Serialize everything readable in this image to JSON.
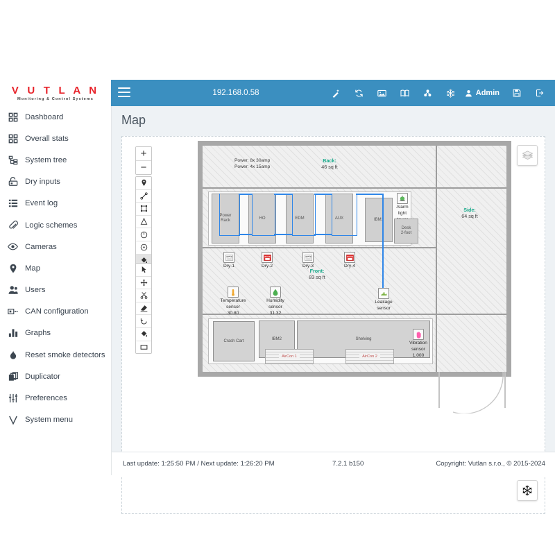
{
  "brand": {
    "name": "V U T L A N",
    "tagline": "Monitoring & Control Systems"
  },
  "header": {
    "ip": "192.168.0.58",
    "user": "Admin",
    "icons": [
      {
        "name": "magic-wand-icon",
        "title": "Wizard"
      },
      {
        "name": "refresh-icon",
        "title": "Refresh"
      },
      {
        "name": "image-icon",
        "title": "Snapshot"
      },
      {
        "name": "book-icon",
        "title": "Manual"
      },
      {
        "name": "sitemap-icon",
        "title": "Topology"
      },
      {
        "name": "snowflake-icon",
        "title": "Cooling"
      }
    ],
    "right_icons": [
      {
        "name": "save-icon",
        "title": "Save"
      },
      {
        "name": "logout-icon",
        "title": "Logout"
      }
    ],
    "menu_icon": "hamburger-icon"
  },
  "sidebar": {
    "items": [
      {
        "label": "Dashboard",
        "icon": "dashboard-grid-icon"
      },
      {
        "label": "Overall stats",
        "icon": "stats-grid-icon"
      },
      {
        "label": "System tree",
        "icon": "tree-icon"
      },
      {
        "label": "Dry inputs",
        "icon": "dry-input-icon"
      },
      {
        "label": "Event log",
        "icon": "list-icon"
      },
      {
        "label": "Logic schemes",
        "icon": "paperclip-icon"
      },
      {
        "label": "Cameras",
        "icon": "eye-icon"
      },
      {
        "label": "Map",
        "icon": "map-pin-icon"
      },
      {
        "label": "Users",
        "icon": "users-icon"
      },
      {
        "label": "CAN configuration",
        "icon": "can-icon"
      },
      {
        "label": "Graphs",
        "icon": "bar-chart-icon"
      },
      {
        "label": "Reset smoke detectors",
        "icon": "flame-icon"
      },
      {
        "label": "Duplicator",
        "icon": "copy-icon"
      },
      {
        "label": "Preferences",
        "icon": "sliders-icon"
      },
      {
        "label": "System menu",
        "icon": "v-letter-icon"
      }
    ]
  },
  "page": {
    "title": "Map"
  },
  "map_toolbar": {
    "zoom_in": "+",
    "zoom_out": "−",
    "draw_tools": [
      {
        "name": "pin-tool",
        "selected": false
      },
      {
        "name": "line-tool",
        "selected": false
      },
      {
        "name": "polygon-tool",
        "selected": false
      },
      {
        "name": "angle-tool",
        "selected": false
      },
      {
        "name": "circle-tool",
        "selected": false
      },
      {
        "name": "dot-circle-tool",
        "selected": false
      },
      {
        "name": "fill-tool",
        "selected": true
      },
      {
        "name": "rectangle-tool",
        "selected": false
      }
    ],
    "edit_tools": [
      {
        "name": "select-tool",
        "selected": false
      },
      {
        "name": "move-tool",
        "selected": false
      },
      {
        "name": "cut-tool",
        "selected": false
      },
      {
        "name": "eraser-tool",
        "selected": false
      },
      {
        "name": "rotate-tool",
        "selected": false
      },
      {
        "name": "fill-tool-2",
        "selected": false
      },
      {
        "name": "rectangle-tool-2",
        "selected": false
      }
    ],
    "layers_button": "layers-icon",
    "cooling_button": "snowflake-icon"
  },
  "floorplan": {
    "power_notes": "Power: 8x 30amp\nPower: 4x 15amp",
    "power_line_1": "Power: 8x 30amp",
    "power_line_2": "Power: 4x 15amp",
    "zones": [
      {
        "name": "Back:",
        "area": "46 sq ft"
      },
      {
        "name": "Side:",
        "area": "64 sq ft"
      },
      {
        "name": "Front:",
        "area": "83 sq ft"
      }
    ],
    "racks": [
      {
        "label": "Power\nRack",
        "l1": "Power",
        "l2": "Rack"
      },
      {
        "label": "HO",
        "l1": "HO",
        "l2": ""
      },
      {
        "label": "EDM",
        "l1": "EDM",
        "l2": ""
      },
      {
        "label": "AUX",
        "l1": "AUX",
        "l2": ""
      },
      {
        "label": "IBM1",
        "l1": "IBM1",
        "l2": ""
      }
    ],
    "desk": {
      "l1": "Desk",
      "l2": "2-foot"
    },
    "alarm": {
      "l1": "Alarm",
      "l2": "light",
      "l3": "tower",
      "icon": "alarm-beacon-icon",
      "color": "#5cb85c"
    },
    "dry_inputs": [
      {
        "label": "Dry-1",
        "state": "open",
        "color": "#f7f7f7"
      },
      {
        "label": "Dry-2",
        "state": "closed",
        "color": "#e03131"
      },
      {
        "label": "Dry-3",
        "state": "open",
        "color": "#f7f7f7"
      },
      {
        "label": "Dry-4",
        "state": "closed",
        "color": "#e03131"
      }
    ],
    "sensors": [
      {
        "name": "Temperature\nsensor",
        "l1": "Temperature",
        "l2": "sensor",
        "value": "30.80",
        "icon": "thermometer-icon",
        "color": "#f0a830"
      },
      {
        "name": "Humidity\nsensor",
        "l1": "Humidity",
        "l2": "sensor",
        "value": "31.32",
        "icon": "water-drop-icon",
        "color": "#4caf50"
      },
      {
        "name": "Leakage\nsensor",
        "l1": "Leakage",
        "l2": "sensor",
        "value": "",
        "icon": "leakage-icon",
        "color": "#7cb342"
      },
      {
        "name": "Vibration\nsensor",
        "l1": "Vibration",
        "l2": "sensor",
        "value": "1.000",
        "icon": "vibration-hand-icon",
        "color": "#ff5fae"
      }
    ],
    "furniture": [
      {
        "label": "Crash Cart"
      },
      {
        "label": "IBM2"
      },
      {
        "label": "Shelving"
      }
    ],
    "airconditioners": [
      {
        "label": "AirCon 1"
      },
      {
        "label": "AirCon 2"
      }
    ]
  },
  "footer": {
    "last_update": "Last update: 1:25:50 PM / Next update: 1:26:20 PM",
    "version": "7.2.1 b150",
    "copyright": "Copyright: Vutlan s.r.o., © 2015-2024"
  },
  "colors": {
    "header": "#3b8fc0",
    "brand": "#e8232a",
    "zone": "#18a98a",
    "cable": "#2f86e8"
  }
}
